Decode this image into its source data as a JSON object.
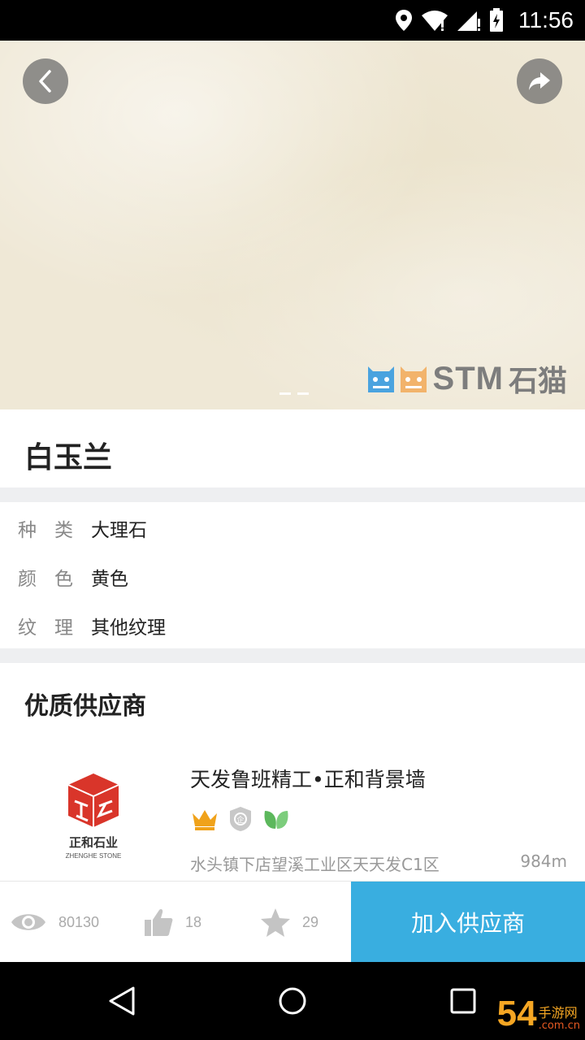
{
  "status_bar": {
    "time": "11:56"
  },
  "hero": {
    "watermark_brand": "STM",
    "watermark_cn": "石猫"
  },
  "product": {
    "name": "白玉兰"
  },
  "properties": [
    {
      "label": "种类",
      "value": "大理石"
    },
    {
      "label": "颜色",
      "value": "黄色"
    },
    {
      "label": "纹理",
      "value": "其他纹理"
    }
  ],
  "suppliers": {
    "section_title": "优质供应商",
    "items": [
      {
        "name": "天发鲁班精工•正和背景墙",
        "logo_text_cn": "正和石业",
        "logo_text_en": "ZHENGHE STONE",
        "address": "水头镇下店望溪工业区天天发C1区",
        "distance": "984m",
        "badges": [
          "crown-icon",
          "enterprise-icon",
          "leaf-icon"
        ]
      }
    ]
  },
  "bottom_bar": {
    "views": "80130",
    "likes": "18",
    "favorites": "29",
    "join_label": "加入供应商"
  },
  "site_watermark": {
    "big": "54",
    "mid": "手游网",
    "domain": ".com.cn"
  },
  "colors": {
    "accent": "#39aee0",
    "logo_red": "#d9352a",
    "crown": "#f0a21a",
    "leaf": "#5cb85c"
  }
}
